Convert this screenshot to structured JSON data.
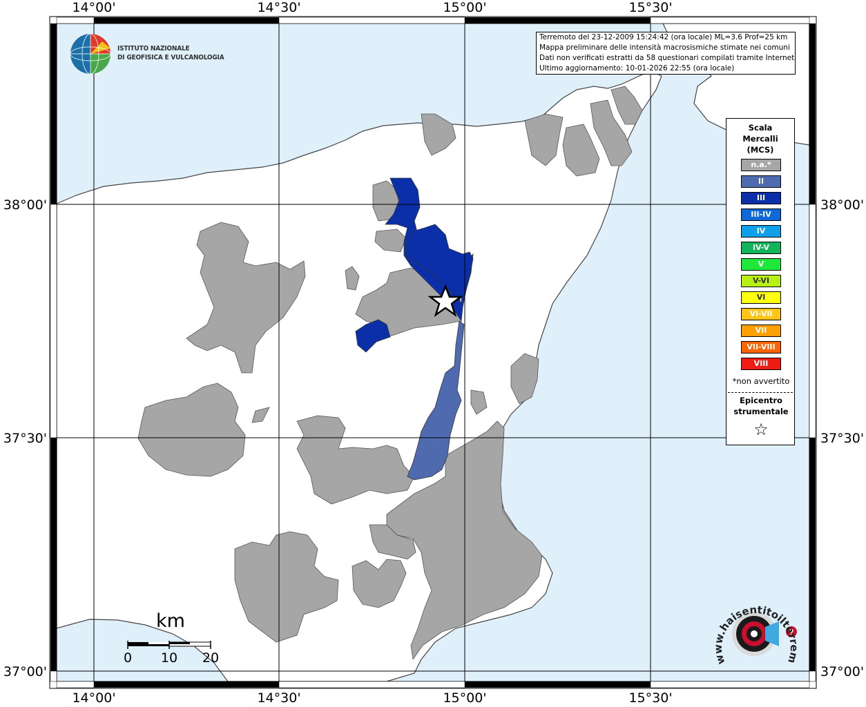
{
  "map": {
    "ticks_top": [
      "14°00'",
      "14°30'",
      "15°00'",
      "15°30'"
    ],
    "ticks_bottom": [
      "14°00'",
      "14°30'",
      "15°00'",
      "15°30'"
    ],
    "ticks_left": [
      "38°00'",
      "37°30'",
      "37°00'"
    ],
    "ticks_right": [
      "38°00'",
      "37°30'",
      "37°00'"
    ]
  },
  "institute": {
    "line1": "ISTITUTO NAZIONALE",
    "line2": "DI GEOFISICA E VULCANOLOGIA"
  },
  "info": {
    "line1": "Terremoto del 23-12-2009 15:24:42 (ora locale) ML=3.6 Prof=25 km",
    "line2": "Mappa preliminare delle intensità macrosismiche stimate nei comuni",
    "line3": "Dati non verificati estratti da 58 questionari compilati tramite Internet.",
    "line4": "Ultimo aggiornamento: 10-01-2026 22:55 (ora locale)"
  },
  "legend": {
    "title1": "Scala",
    "title2": "Mercalli",
    "title3": "(MCS)",
    "items": [
      {
        "label": "n.a.*",
        "color": "#a6a6a6"
      },
      {
        "label": "II",
        "color": "#4f6aaf"
      },
      {
        "label": "III",
        "color": "#0a2fa8"
      },
      {
        "label": "III-IV",
        "color": "#0f68d8"
      },
      {
        "label": "IV",
        "color": "#0ea0e8"
      },
      {
        "label": "IV-V",
        "color": "#12b45a"
      },
      {
        "label": "V",
        "color": "#1ee83a"
      },
      {
        "label": "V-VI",
        "color": "#b8f014"
      },
      {
        "label": "VI",
        "color": "#ffff10"
      },
      {
        "label": "VI-VII",
        "color": "#ffc418"
      },
      {
        "label": "VII",
        "color": "#ffa000"
      },
      {
        "label": "VII-VIII",
        "color": "#ff6400"
      },
      {
        "label": "VIII",
        "color": "#ee1c14"
      }
    ],
    "note": "*non avvertito",
    "epicentro1": "Epicentro",
    "epicentro2": "strumentale",
    "star": "☆"
  },
  "scalebar": {
    "title": "km",
    "labels": [
      "0",
      "10",
      "20"
    ]
  },
  "badge": {
    "arc_text": "www.haisentitoilterremoto.it"
  },
  "colors": {
    "sea": "#dff0fb",
    "land": "#ffffff",
    "na": "#a6a6a6",
    "II": "#4f6aaf",
    "III": "#0a2fa8"
  }
}
